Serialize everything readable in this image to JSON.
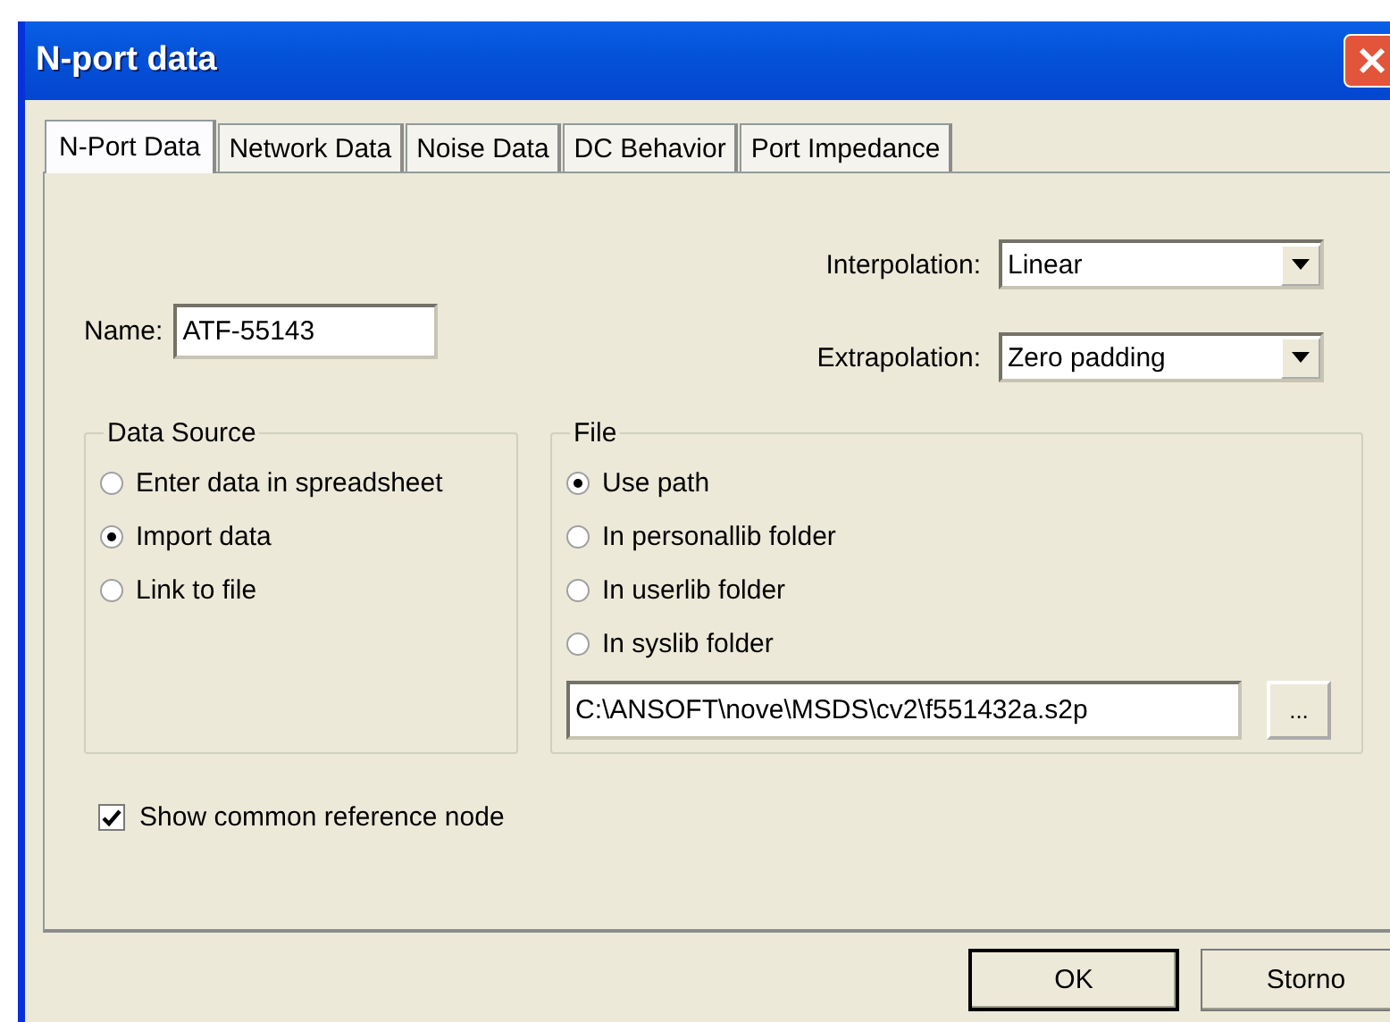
{
  "window": {
    "title": "N-port data"
  },
  "tabs": [
    {
      "label": "N-Port Data",
      "selected": true
    },
    {
      "label": "Network Data",
      "selected": false
    },
    {
      "label": "Noise Data",
      "selected": false
    },
    {
      "label": "DC Behavior",
      "selected": false
    },
    {
      "label": "Port Impedance",
      "selected": false
    }
  ],
  "name_field": {
    "label": "Name:",
    "value": "ATF-55143"
  },
  "interpolation": {
    "label": "Interpolation:",
    "value": "Linear"
  },
  "extrapolation": {
    "label": "Extrapolation:",
    "value": "Zero padding"
  },
  "data_source": {
    "title": "Data Source",
    "options": [
      {
        "label": "Enter data in spreadsheet",
        "selected": false
      },
      {
        "label": "Import data",
        "selected": true
      },
      {
        "label": "Link to file",
        "selected": false
      }
    ]
  },
  "file": {
    "title": "File",
    "options": [
      {
        "label": "Use path",
        "selected": true
      },
      {
        "label": "In personallib folder",
        "selected": false
      },
      {
        "label": "In userlib folder",
        "selected": false
      },
      {
        "label": "In syslib folder",
        "selected": false
      }
    ],
    "path": "C:\\ANSOFT\\nove\\MSDS\\cv2\\f551432a.s2p",
    "browse_button": "..."
  },
  "common_reference": {
    "label": "Show common reference node",
    "checked": true
  },
  "buttons": [
    {
      "label": "OK",
      "default": true
    },
    {
      "label": "Storno",
      "default": false
    }
  ]
}
